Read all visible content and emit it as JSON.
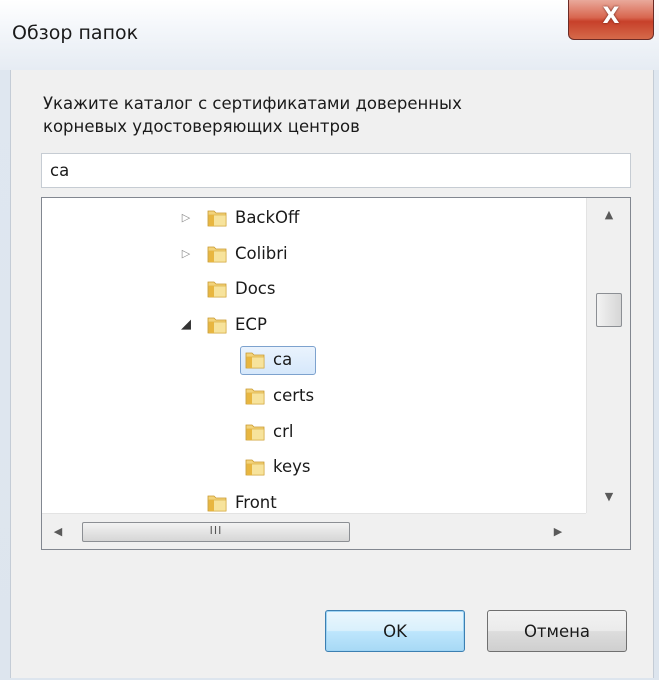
{
  "window": {
    "title": "Обзор папок",
    "close_label": "X"
  },
  "prompt": {
    "line1": "Укажите каталог с сертификатами доверенных",
    "line2": "корневых удостоверяющих центров"
  },
  "path_input": {
    "value": "ca"
  },
  "tree": {
    "items": [
      {
        "label": "BackOff",
        "level": 0,
        "expander": "collapsed",
        "selected": false
      },
      {
        "label": "Colibri",
        "level": 0,
        "expander": "collapsed",
        "selected": false
      },
      {
        "label": "Docs",
        "level": 0,
        "expander": "none",
        "selected": false
      },
      {
        "label": "ECP",
        "level": 0,
        "expander": "expanded",
        "selected": false
      },
      {
        "label": "ca",
        "level": 1,
        "expander": "none",
        "selected": true
      },
      {
        "label": "certs",
        "level": 1,
        "expander": "none",
        "selected": false
      },
      {
        "label": "crl",
        "level": 1,
        "expander": "none",
        "selected": false
      },
      {
        "label": "keys",
        "level": 1,
        "expander": "none",
        "selected": false
      },
      {
        "label": "Front",
        "level": 0,
        "expander": "none",
        "selected": false
      }
    ]
  },
  "scrollbars": {
    "vertical_position": 0.33,
    "horizontal_grip": "III"
  },
  "buttons": {
    "ok": "OK",
    "cancel": "Отмена"
  },
  "icons": {
    "folder": "folder-icon",
    "collapsed": "triangle-right-icon",
    "expanded": "triangle-down-right-icon"
  },
  "colors": {
    "selection_border": "#7da2ce",
    "selection_fill": "#d6e8fb",
    "close_button": "#c7402a",
    "default_button_border": "#3c7fb1",
    "folder": "#e8b640"
  }
}
